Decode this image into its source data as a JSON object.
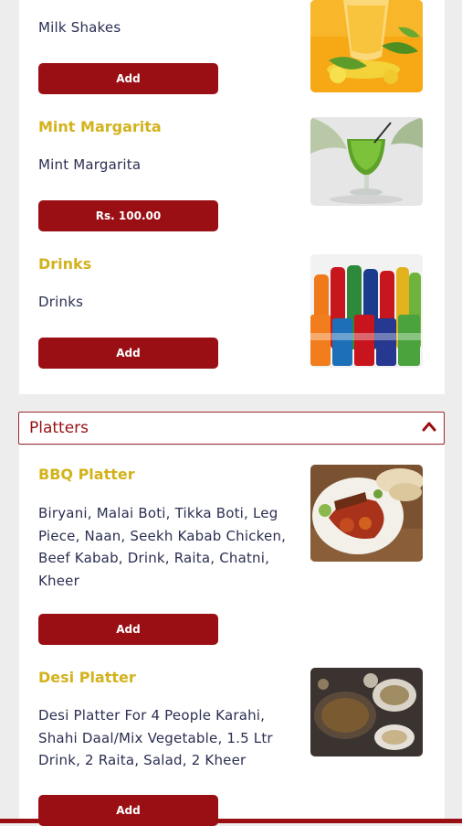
{
  "items_top": [
    {
      "title": "",
      "desc": "Milk Shakes",
      "button": "Add",
      "image_icon": "milkshake-icon"
    },
    {
      "title": "Mint Margarita",
      "desc": "Mint Margarita",
      "button": "Rs. 100.00",
      "image_icon": "mint-margarita-icon"
    },
    {
      "title": "Drinks",
      "desc": "Drinks",
      "button": "Add",
      "image_icon": "soft-drinks-icon"
    }
  ],
  "section": {
    "title": "Platters",
    "icon": "chevron-up-icon"
  },
  "platters": [
    {
      "title": "BBQ Platter",
      "desc": "Biryani,  Malai Boti,  Tikka Boti,  Leg Piece,  Naan,  Seekh Kabab Chicken,  Beef Kabab,   Drink,  Raita, Chatni,  Kheer",
      "button": "Add",
      "image_icon": "bbq-platter-icon"
    },
    {
      "title": "Desi Platter",
      "desc": "Desi Platter For 4 People Karahi, Shahi Daal/Mix Vegetable, 1.5 Ltr Drink, 2 Raita, Salad, 2 Kheer",
      "button": "Add",
      "image_icon": "desi-platter-icon"
    }
  ],
  "colors": {
    "accent": "#990f14",
    "title": "#d3b21c",
    "text": "#2b2f52",
    "background": "#ededed"
  }
}
